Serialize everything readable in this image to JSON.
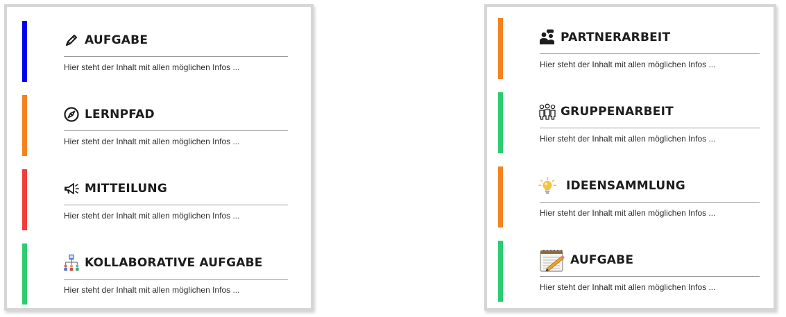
{
  "colors": {
    "blue": "#0000ee",
    "orange": "#f58220",
    "red": "#f23b3b",
    "green": "#2ecc71"
  },
  "left_panel": {
    "cards": [
      {
        "title": "AUFGABE",
        "text": "Hier steht der Inhalt mit allen möglichen Infos ...",
        "icon": "pencil-icon",
        "color": "blue"
      },
      {
        "title": "LERNPFAD",
        "text": "Hier steht der Inhalt mit allen möglichen Infos ...",
        "icon": "compass-icon",
        "color": "orange"
      },
      {
        "title": "MITTEILUNG",
        "text": "Hier steht der Inhalt mit allen möglichen Infos ...",
        "icon": "megaphone-icon",
        "color": "red"
      },
      {
        "title": "KOLLABORATIVE AUFGABE",
        "text": "Hier steht der Inhalt mit allen möglichen Infos ...",
        "icon": "collaboration-network-icon",
        "color": "green"
      }
    ]
  },
  "right_panel": {
    "cards": [
      {
        "title": "PARTNERARBEIT",
        "text": "Hier steht der Inhalt mit allen möglichen Infos ...",
        "icon": "partners-icon",
        "color": "orange"
      },
      {
        "title": "GRUPPENARBEIT",
        "text": "Hier steht der Inhalt mit allen möglichen Infos ...",
        "icon": "group-icon",
        "color": "green"
      },
      {
        "title": "IDEENSAMMLUNG",
        "text": "Hier steht der Inhalt mit allen möglichen Infos ...",
        "icon": "lightbulb-icon",
        "color": "orange"
      },
      {
        "title": "AUFGABE",
        "text": "Hier steht der Inhalt mit allen möglichen Infos ...",
        "icon": "notepad-pencil-icon",
        "color": "green"
      }
    ]
  }
}
